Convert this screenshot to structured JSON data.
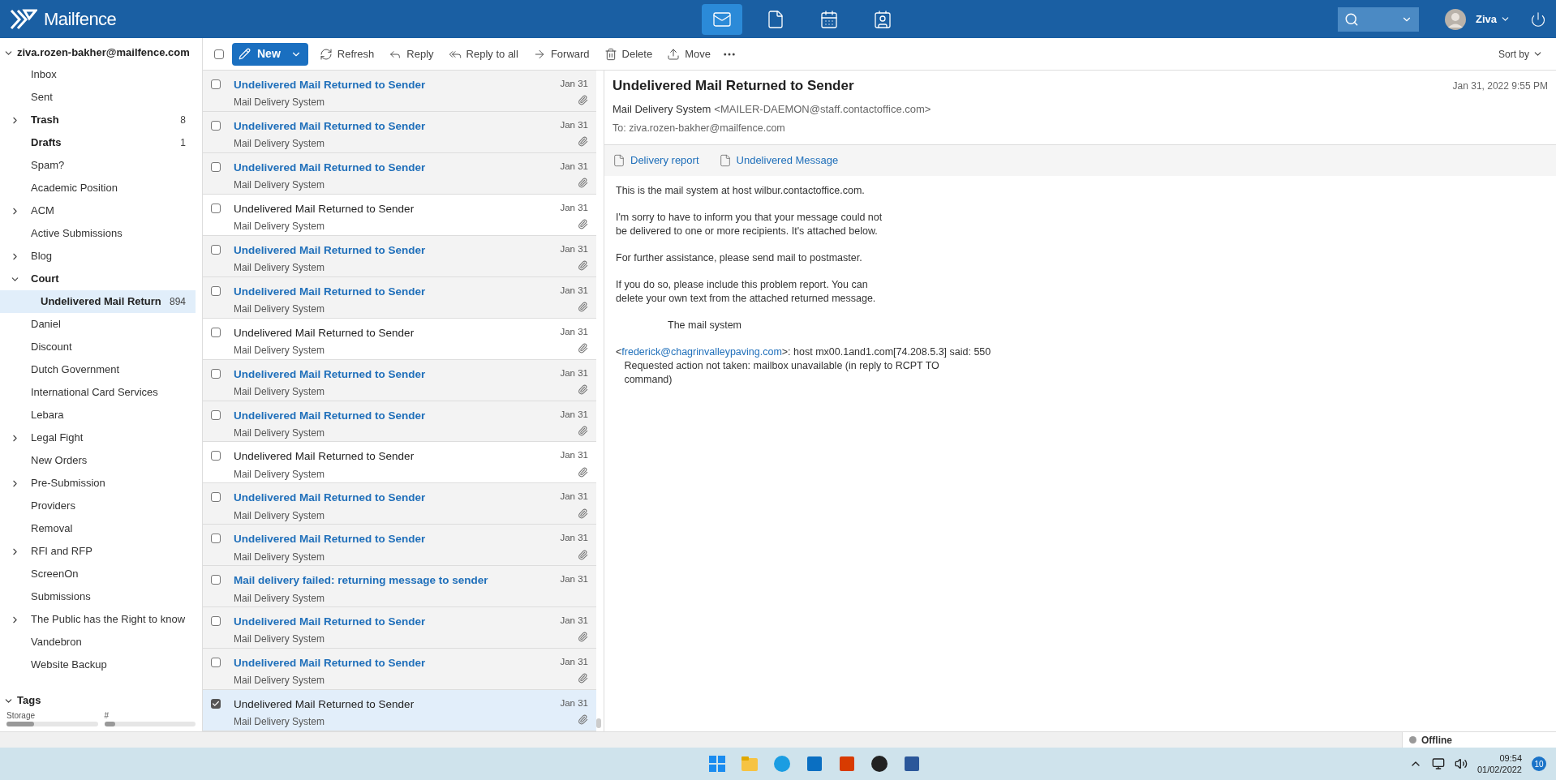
{
  "header": {
    "logo": "Mailfence",
    "apps": [
      {
        "kind": "mail",
        "selected": true
      },
      {
        "kind": "documents",
        "selected": false
      },
      {
        "kind": "calendar",
        "selected": false
      },
      {
        "kind": "contacts",
        "selected": false
      }
    ],
    "user": "Ziva"
  },
  "sidebar": {
    "account": "ziva.rozen-bakher@mailfence.com",
    "folders": [
      {
        "name": "Inbox",
        "bold": false,
        "expandable": false,
        "selected": false
      },
      {
        "name": "Sent",
        "bold": false,
        "expandable": false,
        "selected": false
      },
      {
        "name": "Trash",
        "bold": true,
        "expandable": true,
        "expanded": false,
        "count": "8",
        "selected": false
      },
      {
        "name": "Drafts",
        "bold": true,
        "expandable": false,
        "count": "1",
        "selected": false
      },
      {
        "name": "Spam?",
        "bold": false,
        "expandable": false,
        "selected": false
      },
      {
        "name": "Academic Position",
        "bold": false,
        "expandable": false,
        "selected": false
      },
      {
        "name": "ACM",
        "bold": false,
        "expandable": true,
        "expanded": false,
        "selected": false
      },
      {
        "name": "Active Submissions",
        "bold": false,
        "expandable": false,
        "selected": false
      },
      {
        "name": "Blog",
        "bold": false,
        "expandable": true,
        "expanded": false,
        "selected": false
      },
      {
        "name": "Court",
        "bold": true,
        "expandable": true,
        "expanded": true,
        "selected": false,
        "children": [
          {
            "name": "Undelivered Mail Return",
            "bold": true,
            "expandable": false,
            "count": "894",
            "selected": true
          }
        ]
      },
      {
        "name": "Daniel",
        "bold": false,
        "expandable": false,
        "selected": false
      },
      {
        "name": "Discount",
        "bold": false,
        "expandable": false,
        "selected": false
      },
      {
        "name": "Dutch Government",
        "bold": false,
        "expandable": false,
        "selected": false
      },
      {
        "name": "International Card Services",
        "bold": false,
        "expandable": false,
        "selected": false
      },
      {
        "name": "Lebara",
        "bold": false,
        "expandable": false,
        "selected": false
      },
      {
        "name": "Legal Fight",
        "bold": false,
        "expandable": true,
        "expanded": false,
        "selected": false
      },
      {
        "name": "New Orders",
        "bold": false,
        "expandable": false,
        "selected": false
      },
      {
        "name": "Pre-Submission",
        "bold": false,
        "expandable": true,
        "expanded": false,
        "selected": false
      },
      {
        "name": "Providers",
        "bold": false,
        "expandable": false,
        "selected": false
      },
      {
        "name": "Removal",
        "bold": false,
        "expandable": false,
        "selected": false
      },
      {
        "name": "RFI and RFP",
        "bold": false,
        "expandable": true,
        "expanded": false,
        "selected": false
      },
      {
        "name": "ScreenOn",
        "bold": false,
        "expandable": false,
        "selected": false
      },
      {
        "name": "Submissions",
        "bold": false,
        "expandable": false,
        "selected": false
      },
      {
        "name": "The Public has the Right to know",
        "bold": false,
        "expandable": true,
        "expanded": false,
        "selected": false
      },
      {
        "name": "Vandebron",
        "bold": false,
        "expandable": false,
        "selected": false
      },
      {
        "name": "Website Backup",
        "bold": false,
        "expandable": false,
        "selected": false
      }
    ],
    "tags": {
      "label": "Tags",
      "expanded": true
    },
    "meters": [
      {
        "label": "Storage",
        "level": 0.3
      },
      {
        "label": "#",
        "level": 0.12
      }
    ]
  },
  "toolbar": {
    "select_all_checked": false,
    "new": "New",
    "actions": [
      {
        "kind": "refresh",
        "label": "Refresh"
      },
      {
        "kind": "reply",
        "label": "Reply"
      },
      {
        "kind": "reply_all",
        "label": "Reply to all"
      },
      {
        "kind": "forward",
        "label": "Forward"
      },
      {
        "kind": "delete",
        "label": "Delete"
      },
      {
        "kind": "move",
        "label": "Move"
      }
    ],
    "sort": "Sort by"
  },
  "messages": [
    {
      "subject": "Undelivered Mail Returned to Sender",
      "sender": "Mail Delivery System",
      "date": "Jan 31",
      "unread": true,
      "attachment": true,
      "checked": false,
      "selected": false
    },
    {
      "subject": "Undelivered Mail Returned to Sender",
      "sender": "Mail Delivery System",
      "date": "Jan 31",
      "unread": true,
      "attachment": true,
      "checked": false,
      "selected": false
    },
    {
      "subject": "Undelivered Mail Returned to Sender",
      "sender": "Mail Delivery System",
      "date": "Jan 31",
      "unread": true,
      "attachment": true,
      "checked": false,
      "selected": false
    },
    {
      "subject": "Undelivered Mail Returned to Sender",
      "sender": "Mail Delivery System",
      "date": "Jan 31",
      "unread": false,
      "attachment": true,
      "checked": false,
      "selected": false
    },
    {
      "subject": "Undelivered Mail Returned to Sender",
      "sender": "Mail Delivery System",
      "date": "Jan 31",
      "unread": true,
      "attachment": true,
      "checked": false,
      "selected": false
    },
    {
      "subject": "Undelivered Mail Returned to Sender",
      "sender": "Mail Delivery System",
      "date": "Jan 31",
      "unread": true,
      "attachment": true,
      "checked": false,
      "selected": false
    },
    {
      "subject": "Undelivered Mail Returned to Sender",
      "sender": "Mail Delivery System",
      "date": "Jan 31",
      "unread": false,
      "attachment": true,
      "checked": false,
      "selected": false
    },
    {
      "subject": "Undelivered Mail Returned to Sender",
      "sender": "Mail Delivery System",
      "date": "Jan 31",
      "unread": true,
      "attachment": true,
      "checked": false,
      "selected": false
    },
    {
      "subject": "Undelivered Mail Returned to Sender",
      "sender": "Mail Delivery System",
      "date": "Jan 31",
      "unread": true,
      "attachment": true,
      "checked": false,
      "selected": false
    },
    {
      "subject": "Undelivered Mail Returned to Sender",
      "sender": "Mail Delivery System",
      "date": "Jan 31",
      "unread": false,
      "attachment": true,
      "checked": false,
      "selected": false
    },
    {
      "subject": "Undelivered Mail Returned to Sender",
      "sender": "Mail Delivery System",
      "date": "Jan 31",
      "unread": true,
      "attachment": true,
      "checked": false,
      "selected": false
    },
    {
      "subject": "Undelivered Mail Returned to Sender",
      "sender": "Mail Delivery System",
      "date": "Jan 31",
      "unread": true,
      "attachment": true,
      "checked": false,
      "selected": false
    },
    {
      "subject": "Mail delivery failed: returning message to sender",
      "sender": "Mail Delivery System",
      "date": "Jan 31",
      "unread": true,
      "attachment": false,
      "checked": false,
      "selected": false
    },
    {
      "subject": "Undelivered Mail Returned to Sender",
      "sender": "Mail Delivery System",
      "date": "Jan 31",
      "unread": true,
      "attachment": true,
      "checked": false,
      "selected": false
    },
    {
      "subject": "Undelivered Mail Returned to Sender",
      "sender": "Mail Delivery System",
      "date": "Jan 31",
      "unread": true,
      "attachment": true,
      "checked": false,
      "selected": false
    },
    {
      "subject": "Undelivered Mail Returned to Sender",
      "sender": "Mail Delivery System",
      "date": "Jan 31",
      "unread": false,
      "attachment": true,
      "checked": true,
      "selected": true
    }
  ],
  "reader": {
    "subject": "Undelivered Mail Returned to Sender",
    "date": "Jan 31, 2022 9:55 PM",
    "from_name": "Mail Delivery System",
    "from_address": "<MAILER-DAEMON@staff.contactoffice.com>",
    "to": "To: ziva.rozen-bakher@mailfence.com",
    "attachments": [
      "Delivery report",
      "Undelivered Message"
    ],
    "body": [
      {
        "kind": "text",
        "text": "This is the mail system at host wilbur.contactoffice.com."
      },
      {
        "kind": "text",
        "text": "I'm sorry to have to inform you that your message could not\nbe delivered to one or more recipients. It's attached below."
      },
      {
        "kind": "text",
        "text": "For further assistance, please send mail to postmaster."
      },
      {
        "kind": "text",
        "text": "If you do so, please include this problem report. You can\ndelete your own text from the attached returned message."
      },
      {
        "kind": "signature",
        "text": "The mail system"
      },
      {
        "kind": "bounce",
        "before": "<",
        "link": "frederick@chagrinvalleypaving.com",
        "after": ">: host mx00.1and1.com[74.208.5.3] said: 550\n   Requested action not taken: mailbox unavailable (in reply to RCPT TO\n   command)"
      }
    ]
  },
  "status": {
    "connection": "Offline"
  },
  "taskbar": {
    "time": "09:54",
    "date": "01/02/2022",
    "notifications": "10"
  }
}
